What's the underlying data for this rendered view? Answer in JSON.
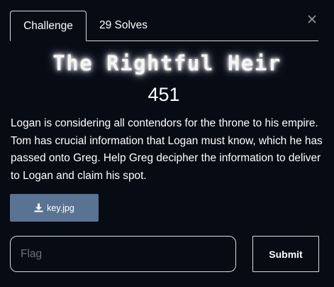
{
  "tabs": [
    {
      "label": "Challenge",
      "active": true
    },
    {
      "label": "29 Solves",
      "active": false
    }
  ],
  "challenge": {
    "name": "The Rightful Heir",
    "points": "451",
    "description": "Logan is considering all contendors for the throne to his empire. Tom has crucial information that Logan must know, which he has passed onto Greg. Help Greg decipher the information to deliver to Logan and claim his spot."
  },
  "file": {
    "name": "key.jpg",
    "icon": "download-icon"
  },
  "flag_input": {
    "placeholder": "Flag",
    "value": ""
  },
  "submit_label": "Submit",
  "close_icon": "close-icon",
  "colors": {
    "background": "#060b14",
    "download_button": "#5b7392",
    "border": "#dcdcdc",
    "placeholder": "#6c737d"
  }
}
